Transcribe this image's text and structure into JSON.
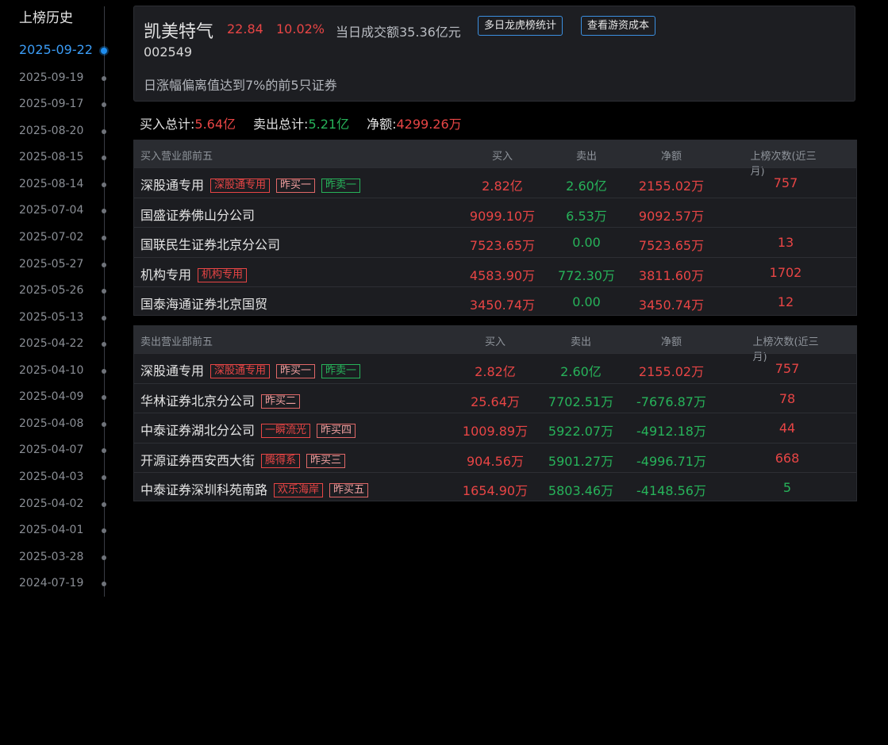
{
  "sidebar": {
    "title": "上榜历史",
    "dates": [
      "2025-09-22",
      "2025-09-19",
      "2025-09-17",
      "2025-08-20",
      "2025-08-15",
      "2025-08-14",
      "2025-07-04",
      "2025-07-02",
      "2025-05-27",
      "2025-05-26",
      "2025-05-13",
      "2025-04-22",
      "2025-04-10",
      "2025-04-09",
      "2025-04-08",
      "2025-04-07",
      "2025-04-03",
      "2025-04-02",
      "2025-04-01",
      "2025-03-28",
      "2024-07-19"
    ],
    "active_index": 0
  },
  "header": {
    "name": "凯美特气",
    "price": "22.84",
    "change": "10.02%",
    "turnover": "当日成交额35.36亿元",
    "btn_multi_day": "多日龙虎榜统计",
    "btn_cost": "查看游资成本",
    "code": "002549",
    "reason": "日涨幅偏离值达到7%的前5只证券"
  },
  "summary": {
    "buy_label": "买入总计:",
    "buy_value": "5.64亿",
    "sell_label": "卖出总计:",
    "sell_value": "5.21亿",
    "net_label": "净额:",
    "net_value": "4299.26万"
  },
  "buy_table": {
    "headers": [
      "买入营业部前五",
      "买入",
      "卖出",
      "净额",
      "上榜次数(近三月)"
    ],
    "rows": [
      {
        "name": "深股通专用",
        "tags": [
          {
            "text": "深股通专用",
            "style": "red"
          },
          {
            "text": "昨买一",
            "style": "pink"
          },
          {
            "text": "昨卖一",
            "style": "green"
          }
        ],
        "buy": "2.82亿",
        "sell": "2.60亿",
        "net": "2155.02万",
        "net_color": "red",
        "count": "757",
        "count_color": "red"
      },
      {
        "name": "国盛证券佛山分公司",
        "tags": [],
        "buy": "9099.10万",
        "sell": "6.53万",
        "net": "9092.57万",
        "net_color": "red",
        "count": "",
        "count_color": "red"
      },
      {
        "name": "国联民生证券北京分公司",
        "tags": [],
        "buy": "7523.65万",
        "sell": "0.00",
        "net": "7523.65万",
        "net_color": "red",
        "count": "13",
        "count_color": "red"
      },
      {
        "name": "机构专用",
        "tags": [
          {
            "text": "机构专用",
            "style": "red"
          }
        ],
        "buy": "4583.90万",
        "sell": "772.30万",
        "net": "3811.60万",
        "net_color": "red",
        "count": "1702",
        "count_color": "red"
      },
      {
        "name": "国泰海通证券北京国贸",
        "tags": [],
        "buy": "3450.74万",
        "sell": "0.00",
        "net": "3450.74万",
        "net_color": "red",
        "count": "12",
        "count_color": "red"
      }
    ]
  },
  "sell_table": {
    "headers": [
      "卖出营业部前五",
      "买入",
      "卖出",
      "净额",
      "上榜次数(近三月)"
    ],
    "rows": [
      {
        "name": "深股通专用",
        "tags": [
          {
            "text": "深股通专用",
            "style": "red"
          },
          {
            "text": "昨买一",
            "style": "pink"
          },
          {
            "text": "昨卖一",
            "style": "green"
          }
        ],
        "buy": "2.82亿",
        "sell": "2.60亿",
        "net": "2155.02万",
        "net_color": "red",
        "count": "757",
        "count_color": "red"
      },
      {
        "name": "华林证券北京分公司",
        "tags": [
          {
            "text": "昨买二",
            "style": "pink"
          }
        ],
        "buy": "25.64万",
        "sell": "7702.51万",
        "net": "-7676.87万",
        "net_color": "green",
        "count": "78",
        "count_color": "red"
      },
      {
        "name": "中泰证券湖北分公司",
        "tags": [
          {
            "text": "一瞬流光",
            "style": "red"
          },
          {
            "text": "昨买四",
            "style": "pink"
          }
        ],
        "buy": "1009.89万",
        "sell": "5922.07万",
        "net": "-4912.18万",
        "net_color": "green",
        "count": "44",
        "count_color": "red"
      },
      {
        "name": "开源证券西安西大街",
        "tags": [
          {
            "text": "腾得系",
            "style": "red"
          },
          {
            "text": "昨买三",
            "style": "pink"
          }
        ],
        "buy": "904.56万",
        "sell": "5901.27万",
        "net": "-4996.71万",
        "net_color": "green",
        "count": "668",
        "count_color": "red"
      },
      {
        "name": "中泰证券深圳科苑南路",
        "tags": [
          {
            "text": "欢乐海岸",
            "style": "red"
          },
          {
            "text": "昨买五",
            "style": "pink"
          }
        ],
        "buy": "1654.90万",
        "sell": "5803.46万",
        "net": "-4148.56万",
        "net_color": "green",
        "count": "5",
        "count_color": "green"
      }
    ]
  }
}
